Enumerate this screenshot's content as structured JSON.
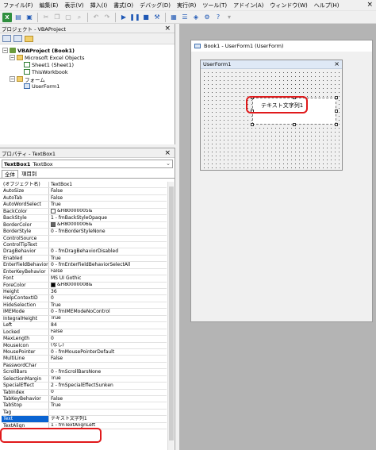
{
  "menubar": {
    "items": [
      "ファイル(F)",
      "編集(E)",
      "表示(V)",
      "挿入(I)",
      "書式(O)",
      "デバッグ(D)",
      "実行(R)",
      "ツール(T)",
      "アドイン(A)",
      "ウィンドウ(W)",
      "ヘルプ(H)"
    ],
    "close_glyph": "×"
  },
  "project_panel": {
    "title": "プロジェクト - VBAProject",
    "close_glyph": "×",
    "tree": {
      "project": "VBAProject (Book1)",
      "excel_objects_folder": "Microsoft Excel Objects",
      "sheet1": "Sheet1 (Sheet1)",
      "thisworkbook": "ThisWorkbook",
      "forms_folder": "フォーム",
      "userform1": "UserForm1"
    }
  },
  "props_panel": {
    "title": "プロパティ - TextBox1",
    "close_glyph": "×",
    "object_name": "TextBox1",
    "object_type": "TextBox",
    "tabs": [
      "全体",
      "項目別"
    ],
    "rows": [
      {
        "name": "(オブジェクト名)",
        "value": "TextBox1"
      },
      {
        "name": "AutoSize",
        "value": "False"
      },
      {
        "name": "AutoTab",
        "value": "False"
      },
      {
        "name": "AutoWordSelect",
        "value": "True"
      },
      {
        "name": "BackColor",
        "value": "&H80000005&",
        "swatch": "#ffffff"
      },
      {
        "name": "BackStyle",
        "value": "1 - fmBackStyleOpaque"
      },
      {
        "name": "BorderColor",
        "value": "&H80000006&",
        "swatch": "#646464"
      },
      {
        "name": "BorderStyle",
        "value": "0 - fmBorderStyleNone"
      },
      {
        "name": "ControlSource",
        "value": ""
      },
      {
        "name": "ControlTipText",
        "value": ""
      },
      {
        "name": "DragBehavior",
        "value": "0 - fmDragBehaviorDisabled"
      },
      {
        "name": "Enabled",
        "value": "True"
      },
      {
        "name": "EnterFieldBehavior",
        "value": "0 - fmEnterFieldBehaviorSelectAll"
      },
      {
        "name": "EnterKeyBehavior",
        "value": "False"
      },
      {
        "name": "Font",
        "value": "MS UI Gothic"
      },
      {
        "name": "ForeColor",
        "value": "&H80000008&",
        "swatch": "#000000"
      },
      {
        "name": "Height",
        "value": "36"
      },
      {
        "name": "HelpContextID",
        "value": "0"
      },
      {
        "name": "HideSelection",
        "value": "True"
      },
      {
        "name": "IMEMode",
        "value": "0 - fmIMEModeNoControl"
      },
      {
        "name": "IntegralHeight",
        "value": "True"
      },
      {
        "name": "Left",
        "value": "84"
      },
      {
        "name": "Locked",
        "value": "False"
      },
      {
        "name": "MaxLength",
        "value": "0"
      },
      {
        "name": "MouseIcon",
        "value": "(なし)"
      },
      {
        "name": "MousePointer",
        "value": "0 - fmMousePointerDefault"
      },
      {
        "name": "MultiLine",
        "value": "False"
      },
      {
        "name": "PasswordChar",
        "value": ""
      },
      {
        "name": "ScrollBars",
        "value": "0 - fmScrollBarsNone"
      },
      {
        "name": "SelectionMargin",
        "value": "True"
      },
      {
        "name": "SpecialEffect",
        "value": "2 - fmSpecialEffectSunken"
      },
      {
        "name": "TabIndex",
        "value": "0"
      },
      {
        "name": "TabKeyBehavior",
        "value": "False"
      },
      {
        "name": "TabStop",
        "value": "True"
      },
      {
        "name": "Tag",
        "value": ""
      },
      {
        "name": "Text",
        "value": "テキスト文字列1",
        "selected": true
      },
      {
        "name": "TextAlign",
        "value": "1 - fmTextAlignLeft"
      }
    ]
  },
  "designer": {
    "window_title": "Book1 - UserForm1 (UserForm)",
    "userform_caption": "UserForm1",
    "userform_close_glyph": "×",
    "textbox_text": "テキスト文字列1"
  },
  "colors": {
    "highlight": "#e0191b",
    "selection": "#0a64d2"
  }
}
